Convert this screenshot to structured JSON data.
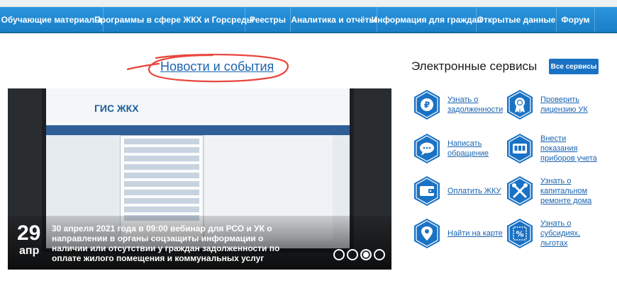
{
  "nav": {
    "items": [
      "Обучающие материалы",
      "Программы в сфере ЖКХ и Горсреды",
      "Реестры",
      "Аналитика и отчёты",
      "Информация для граждан",
      "Открытые данные",
      "Форум"
    ]
  },
  "news": {
    "title": "Новости и события",
    "slide": {
      "day": "29",
      "month": "апр",
      "caption": "30 апреля 2021 года в 09:00 вебинар для РСО и УК о направлении в органы соцзащиты информации о наличии или отсутствии у граждан задолженности по оплате жилого помещения и коммунальных услуг",
      "screen_logo": "ГИС ЖКХ"
    },
    "slides_count": 4,
    "active_slide": 3
  },
  "services": {
    "title": "Электронные сервисы",
    "all_button": "Все сервисы",
    "items": [
      {
        "label": "Узнать о\nзадолженности",
        "icon": "ruble-coin-icon"
      },
      {
        "label": "Проверить\nлицензию УК",
        "icon": "award-badge-icon"
      },
      {
        "label": "Написать\nобращение",
        "icon": "chat-bubble-icon"
      },
      {
        "label": "Внести\nпоказания\nприборов учета",
        "icon": "meter-counter-icon"
      },
      {
        "label": "Оплатить ЖКУ",
        "icon": "wallet-icon"
      },
      {
        "label": "Узнать о\nкапитальном\nремонте дома",
        "icon": "tools-icon"
      },
      {
        "label": "Найти на карте",
        "icon": "map-pin-icon"
      },
      {
        "label": "Узнать о\nсубсидиях,\nльготах",
        "icon": "percent-stamp-icon"
      }
    ]
  },
  "colors": {
    "nav_blue": "#1d8ad6",
    "link_blue": "#1a63b0",
    "accent_red": "#e8463c",
    "hex_blue": "#1a72c4"
  }
}
